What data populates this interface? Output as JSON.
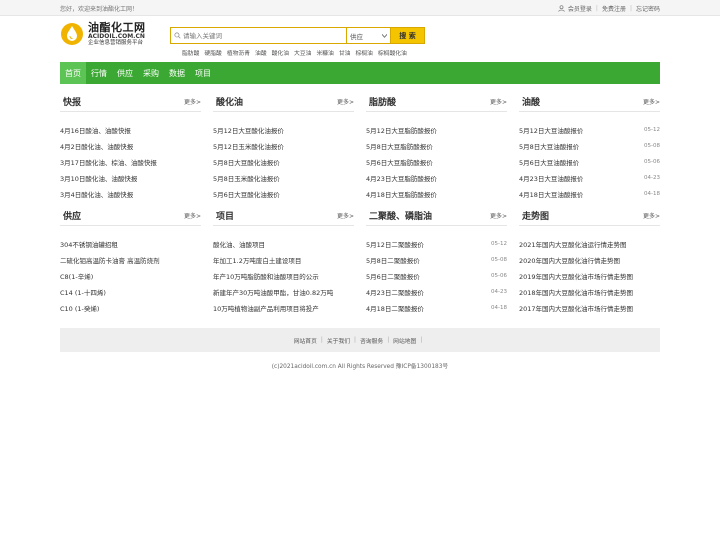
{
  "topbar": {
    "welcome": "您好，欢迎来到油酯化工网！",
    "login": "会员登录",
    "register": "免费注册",
    "forgot": "忘记密码"
  },
  "logo": {
    "cn": "油酯化工网",
    "en": "ACIDOIL.COM.CN",
    "sub": "企业信息营销服务平台"
  },
  "search": {
    "placeholder": "请输入关键词",
    "select_value": "供应",
    "button": "搜 索"
  },
  "hotwords": [
    "脂肪酸",
    "硬脂酸",
    "植物沥青",
    "油酸",
    "酸化油",
    "大豆油",
    "米糠油",
    "甘油",
    "棕榈油",
    "棕榈酸化油"
  ],
  "nav": [
    "首页",
    "行情",
    "供应",
    "采购",
    "数据",
    "项目"
  ],
  "more_label": "更多>",
  "row1": [
    {
      "title": "快报",
      "items": [
        {
          "t": "4月16日酸油、油酸快报",
          "d": ""
        },
        {
          "t": "4月2日酸化油、油酸快报",
          "d": ""
        },
        {
          "t": "3月17日酸化油、棕油、油酸快报",
          "d": ""
        },
        {
          "t": "3月10日酸化油、油酸快报",
          "d": ""
        },
        {
          "t": "3月4日酸化油、油酸快报",
          "d": ""
        }
      ]
    },
    {
      "title": "酸化油",
      "items": [
        {
          "t": "5月12日大豆酸化油报价",
          "d": ""
        },
        {
          "t": "5月12日玉米酸化油报价",
          "d": ""
        },
        {
          "t": "5月8日大豆酸化油报价",
          "d": ""
        },
        {
          "t": "5月8日玉米酸化油报价",
          "d": ""
        },
        {
          "t": "5月6日大豆酸化油报价",
          "d": ""
        }
      ]
    },
    {
      "title": "脂肪酸",
      "items": [
        {
          "t": "5月12日大豆脂肪酸报价",
          "d": ""
        },
        {
          "t": "5月8日大豆脂肪酸报价",
          "d": ""
        },
        {
          "t": "5月6日大豆脂肪酸报价",
          "d": ""
        },
        {
          "t": "4月23日大豆脂肪酸报价",
          "d": ""
        },
        {
          "t": "4月18日大豆脂肪酸报价",
          "d": ""
        }
      ]
    },
    {
      "title": "油酸",
      "items": [
        {
          "t": "5月12日大豆油酸报价",
          "d": "05-12"
        },
        {
          "t": "5月8日大豆油酸报价",
          "d": "05-08"
        },
        {
          "t": "5月6日大豆油酸报价",
          "d": "05-06"
        },
        {
          "t": "4月23日大豆油酸报价",
          "d": "04-23"
        },
        {
          "t": "4月18日大豆油酸报价",
          "d": "04-18"
        }
      ]
    }
  ],
  "row2": [
    {
      "title": "供应",
      "items": [
        {
          "t": "304不锈钢油罐招租",
          "d": ""
        },
        {
          "t": "二硫化钼高温防卡油膏 高温防烧剂",
          "d": ""
        },
        {
          "t": "C8(1-辛烯)",
          "d": ""
        },
        {
          "t": "C14 (1-十四烯)",
          "d": ""
        },
        {
          "t": "C10 (1-癸烯)",
          "d": ""
        }
      ]
    },
    {
      "title": "项目",
      "items": [
        {
          "t": "酸化油、油酸项目",
          "d": ""
        },
        {
          "t": "年加工1.2万吨废白土建设项目",
          "d": ""
        },
        {
          "t": "年产10万吨脂肪酸和油酸项目的公示",
          "d": ""
        },
        {
          "t": "新建年产30万吨油酸甲酯，甘油0.82万吨",
          "d": ""
        },
        {
          "t": "10万吨植物油副产品利用项目将投产",
          "d": ""
        }
      ]
    },
    {
      "title": "二聚酸、磷脂油",
      "items": [
        {
          "t": "5月12日二聚酸报价",
          "d": "05-12"
        },
        {
          "t": "5月8日二聚酸报价",
          "d": "05-08"
        },
        {
          "t": "5月6日二聚酸报价",
          "d": "05-06"
        },
        {
          "t": "4月23日二聚酸报价",
          "d": "04-23"
        },
        {
          "t": "4月18日二聚酸报价",
          "d": "04-18"
        }
      ]
    },
    {
      "title": "走势图",
      "items": [
        {
          "t": "2021年国内大豆酸化油运行情走势图",
          "d": ""
        },
        {
          "t": "2020年国内大豆酸化油行情走势图",
          "d": ""
        },
        {
          "t": "2019年国内大豆酸化油市场行情走势图",
          "d": ""
        },
        {
          "t": "2018年国内大豆酸化油市场行情走势图",
          "d": ""
        },
        {
          "t": "2017年国内大豆酸化油市场行情走势图",
          "d": ""
        }
      ]
    }
  ],
  "footer": {
    "links": [
      "网站首页",
      "关于我们",
      "咨询服务",
      "网站地图"
    ],
    "copyright": "(c)2021acidoil.com.cn All Rights Reserved 豫ICP备1300183号"
  },
  "colors": {
    "nav_bg": "#3aa832",
    "nav_active": "#5cc454",
    "search_btn": "#f5c400",
    "logo_yellow": "#f0b400"
  }
}
